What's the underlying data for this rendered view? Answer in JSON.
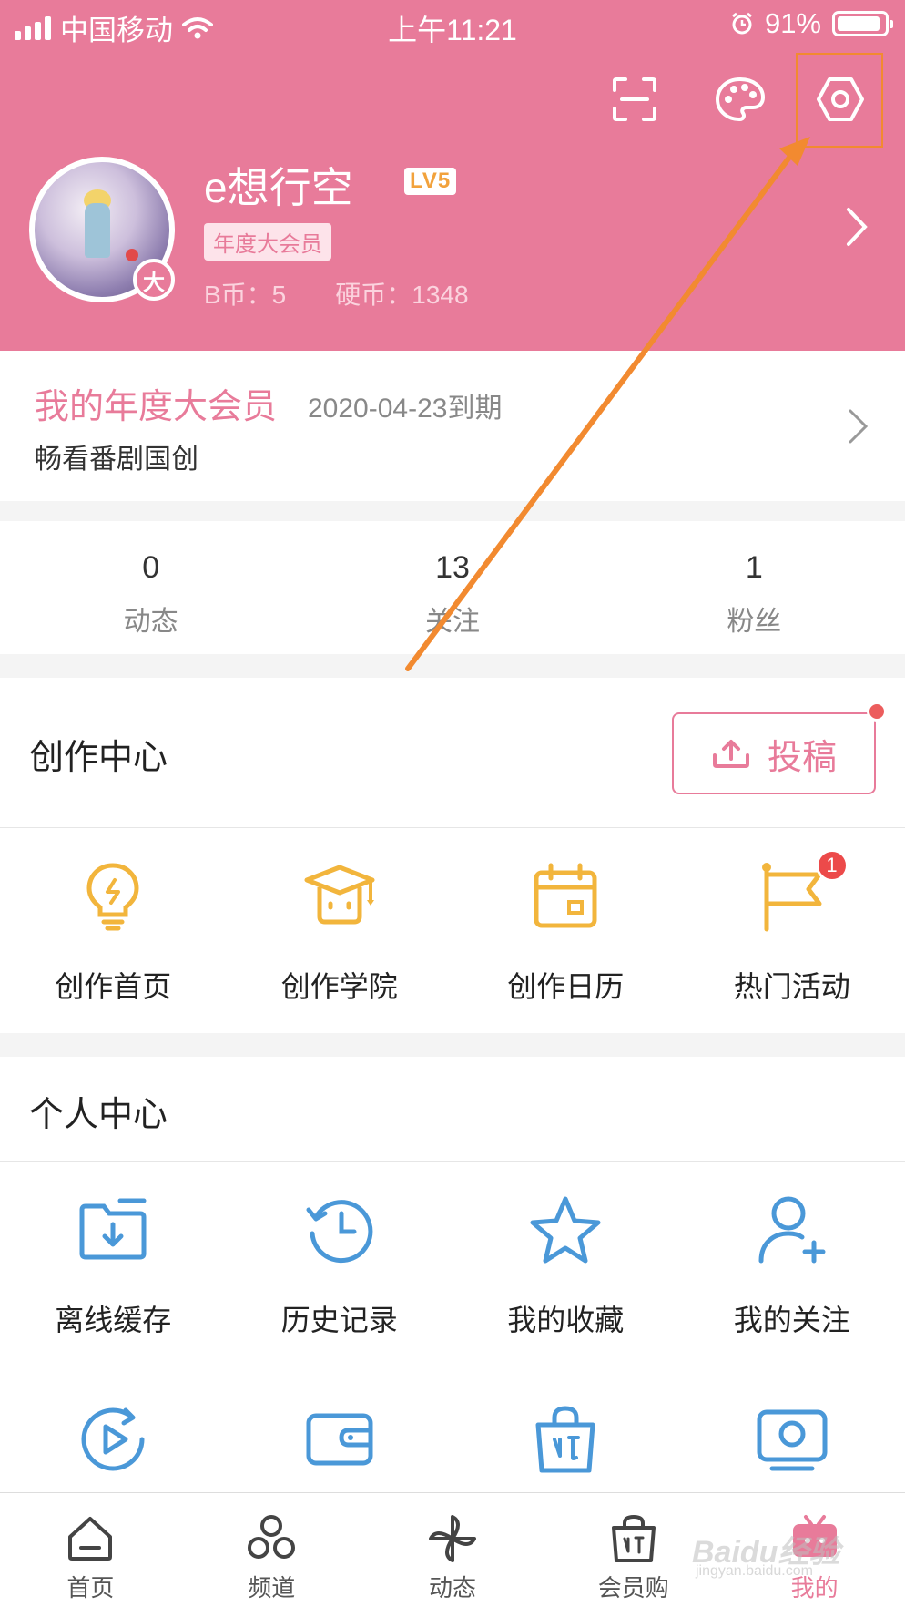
{
  "status_bar": {
    "carrier": "中国移动",
    "time": "上午11:21",
    "battery": "91%"
  },
  "header": {
    "username": "e想行空",
    "level": "LV5",
    "avatar_badge": "大",
    "vip_tag": "年度大会员",
    "b_coins": "B币：5",
    "hard_coins": "硬币：1348",
    "icons": [
      "scan-icon",
      "palette-icon",
      "settings-icon"
    ]
  },
  "membership": {
    "title": "我的年度大会员",
    "expire": "2020-04-23到期",
    "subtitle": "畅看番剧国创"
  },
  "stats": [
    {
      "value": "0",
      "label": "动态"
    },
    {
      "value": "13",
      "label": "关注"
    },
    {
      "value": "1",
      "label": "粉丝"
    }
  ],
  "creation": {
    "title": "创作中心",
    "upload_label": "投稿",
    "items": [
      {
        "label": "创作首页",
        "icon": "lightbulb-icon"
      },
      {
        "label": "创作学院",
        "icon": "graduation-cap-icon"
      },
      {
        "label": "创作日历",
        "icon": "calendar-icon"
      },
      {
        "label": "热门活动",
        "icon": "flag-icon",
        "badge": "1"
      }
    ]
  },
  "personal": {
    "title": "个人中心",
    "items": [
      {
        "label": "离线缓存",
        "icon": "download-folder-icon"
      },
      {
        "label": "历史记录",
        "icon": "history-clock-icon"
      },
      {
        "label": "我的收藏",
        "icon": "star-icon"
      },
      {
        "label": "我的关注",
        "icon": "add-user-icon"
      }
    ],
    "more_icons": [
      "play-later-icon",
      "wallet-icon",
      "shopping-bag-icon",
      "tv-icon"
    ]
  },
  "tabbar": [
    {
      "label": "首页",
      "icon": "home-icon"
    },
    {
      "label": "频道",
      "icon": "channel-icon"
    },
    {
      "label": "动态",
      "icon": "pinwheel-icon"
    },
    {
      "label": "会员购",
      "icon": "shopping-bag-icon"
    },
    {
      "label": "我的",
      "icon": "tv-icon",
      "active": true
    }
  ],
  "watermark": {
    "text": "Baidu经验",
    "sub": "jingyan.baidu.com"
  },
  "colors": {
    "brand_pink": "#e87b9a",
    "create_yellow": "#f2b53c",
    "personal_blue": "#4a98d8",
    "annotation_orange": "#f28a30"
  }
}
